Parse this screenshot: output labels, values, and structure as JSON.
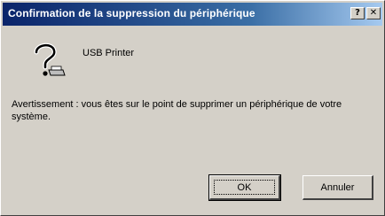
{
  "titlebar": {
    "title": "Confirmation de la suppression du périphérique",
    "help_glyph": "?",
    "close_glyph": "✕"
  },
  "device": {
    "icon": "question-mark-icon",
    "name": "USB Printer"
  },
  "message": "Avertissement : vous êtes sur le point de supprimer un périphérique de votre système.",
  "buttons": {
    "ok_label": "OK",
    "cancel_label": "Annuler"
  },
  "colors": {
    "titlebar_start": "#0a246a",
    "titlebar_end": "#a6caf0",
    "face": "#d4d0c8"
  }
}
